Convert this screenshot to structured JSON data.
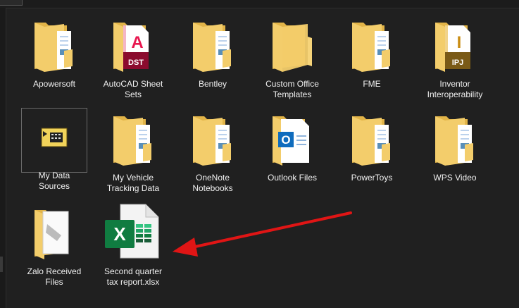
{
  "items": [
    {
      "label": "Apowersoft",
      "type": "folder-doc"
    },
    {
      "label": "AutoCAD Sheet Sets",
      "type": "folder-dst",
      "badge": "DST",
      "letter": "A"
    },
    {
      "label": "Bentley",
      "type": "folder-doc"
    },
    {
      "label": "Custom Office Templates",
      "type": "folder"
    },
    {
      "label": "FME",
      "type": "folder-doc"
    },
    {
      "label": "Inventor Interoperability",
      "type": "folder-ipj",
      "badge": "IPJ",
      "letter": "I"
    },
    {
      "label": "My Data Sources",
      "type": "data-sources",
      "selected": true
    },
    {
      "label": "My Vehicle Tracking Data",
      "type": "folder-doc"
    },
    {
      "label": "OneNote Notebooks",
      "type": "folder-doc"
    },
    {
      "label": "Outlook Files",
      "type": "outlook",
      "letter": "O"
    },
    {
      "label": "PowerToys",
      "type": "folder-doc"
    },
    {
      "label": "WPS Video",
      "type": "folder-doc"
    },
    {
      "label": "Zalo Received Files",
      "type": "folder-img"
    },
    {
      "label": "Second quarter tax report.xlsx",
      "type": "xlsx",
      "letter": "X"
    }
  ],
  "colors": {
    "folder": "#f3cd6b",
    "folder_dark": "#e2b448",
    "autocad": "#8b0b2e",
    "inventor": "#7a5a17",
    "excel": "#107c41",
    "outlook": "#0f6cbd",
    "arrow": "#e01515"
  }
}
